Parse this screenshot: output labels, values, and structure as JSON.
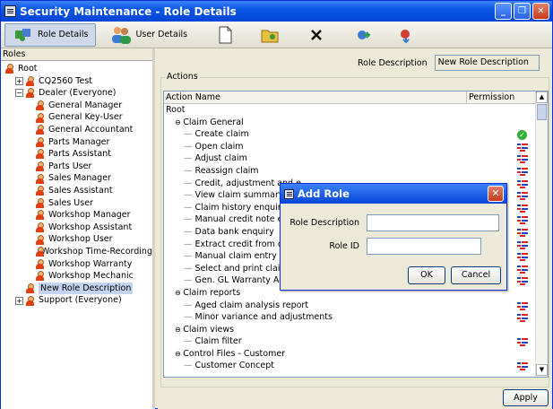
{
  "window": {
    "title": "Security Maintenance - Role Details",
    "controls": [
      "_",
      "❐",
      "✕"
    ]
  },
  "toolbar": {
    "role_details": "Role Details",
    "user_details": "User Details"
  },
  "roles": {
    "header": "Roles",
    "items": [
      {
        "label": "Root",
        "level": 0,
        "pm": ""
      },
      {
        "label": "CQ2560 Test",
        "level": 1,
        "pm": "+"
      },
      {
        "label": "Dealer (Everyone)",
        "level": 1,
        "pm": "−"
      },
      {
        "label": "General Manager",
        "level": 2,
        "pm": ""
      },
      {
        "label": "General Key-User",
        "level": 2,
        "pm": ""
      },
      {
        "label": "General Accountant",
        "level": 2,
        "pm": ""
      },
      {
        "label": "Parts Manager",
        "level": 2,
        "pm": ""
      },
      {
        "label": "Parts Assistant",
        "level": 2,
        "pm": ""
      },
      {
        "label": "Parts User",
        "level": 2,
        "pm": ""
      },
      {
        "label": "Sales Manager",
        "level": 2,
        "pm": ""
      },
      {
        "label": "Sales Assistant",
        "level": 2,
        "pm": ""
      },
      {
        "label": "Sales User",
        "level": 2,
        "pm": ""
      },
      {
        "label": "Workshop Manager",
        "level": 2,
        "pm": ""
      },
      {
        "label": "Workshop Assistant",
        "level": 2,
        "pm": ""
      },
      {
        "label": "Workshop User",
        "level": 2,
        "pm": ""
      },
      {
        "label": "Workshop Time-Recording",
        "level": 2,
        "pm": ""
      },
      {
        "label": "Workshop Warranty",
        "level": 2,
        "pm": ""
      },
      {
        "label": "Workshop Mechanic",
        "level": 2,
        "pm": ""
      },
      {
        "label": "New Role Description",
        "level": 1,
        "pm": "",
        "selected": true
      },
      {
        "label": "Support (Everyone)",
        "level": 1,
        "pm": "+"
      }
    ]
  },
  "details": {
    "role_description_label": "Role Description",
    "role_description_value": "New Role Description",
    "actions_legend": "Actions",
    "col_action_name": "Action Name",
    "col_permission": "Permission",
    "apply": "Apply",
    "rows": [
      {
        "label": "Root",
        "level": 0,
        "pm": "",
        "perm": ""
      },
      {
        "label": "Claim General",
        "level": 1,
        "pm": "−",
        "perm": ""
      },
      {
        "label": "Create claim",
        "level": 2,
        "pm": "",
        "perm": "check"
      },
      {
        "label": "Open claim",
        "level": 2,
        "pm": "",
        "perm": "deny"
      },
      {
        "label": "Adjust claim",
        "level": 2,
        "pm": "",
        "perm": "deny"
      },
      {
        "label": "Reassign claim",
        "level": 2,
        "pm": "",
        "perm": "deny"
      },
      {
        "label": "Credit, adjustment and e",
        "level": 2,
        "pm": "",
        "perm": "deny"
      },
      {
        "label": "View claim summary",
        "level": 2,
        "pm": "",
        "perm": "deny"
      },
      {
        "label": "Claim history enquiry",
        "level": 2,
        "pm": "",
        "perm": "deny"
      },
      {
        "label": "Manual credit note entry",
        "level": 2,
        "pm": "",
        "perm": "deny"
      },
      {
        "label": "Data bank enquiry",
        "level": 2,
        "pm": "",
        "perm": "deny"
      },
      {
        "label": "Extract credit from data",
        "level": 2,
        "pm": "",
        "perm": "deny"
      },
      {
        "label": "Manual claim entry",
        "level": 2,
        "pm": "",
        "perm": "deny"
      },
      {
        "label": "Select and print claims",
        "level": 2,
        "pm": "",
        "perm": "deny"
      },
      {
        "label": "Gen. GL Warranty Adjus",
        "level": 2,
        "pm": "",
        "perm": "deny"
      },
      {
        "label": "Claim reports",
        "level": 1,
        "pm": "−",
        "perm": ""
      },
      {
        "label": "Aged claim analysis report",
        "level": 2,
        "pm": "",
        "perm": "deny"
      },
      {
        "label": "Minor variance and adjustments",
        "level": 2,
        "pm": "",
        "perm": "deny"
      },
      {
        "label": "Claim views",
        "level": 1,
        "pm": "−",
        "perm": ""
      },
      {
        "label": "Claim filter",
        "level": 2,
        "pm": "",
        "perm": "deny"
      },
      {
        "label": "Control Files - Customer",
        "level": 1,
        "pm": "−",
        "perm": ""
      },
      {
        "label": "Customer Concept",
        "level": 2,
        "pm": "",
        "perm": "deny"
      }
    ]
  },
  "dialog": {
    "title": "Add Role",
    "role_description_label": "Role Description",
    "role_description_value": "",
    "role_id_label": "Role ID",
    "role_id_value": "",
    "ok": "OK",
    "cancel": "Cancel"
  },
  "colors": {
    "titlebar": "#0445d8",
    "check": "#2fae2f",
    "deny_red": "#e02020",
    "deny_blue": "#2040c0"
  }
}
